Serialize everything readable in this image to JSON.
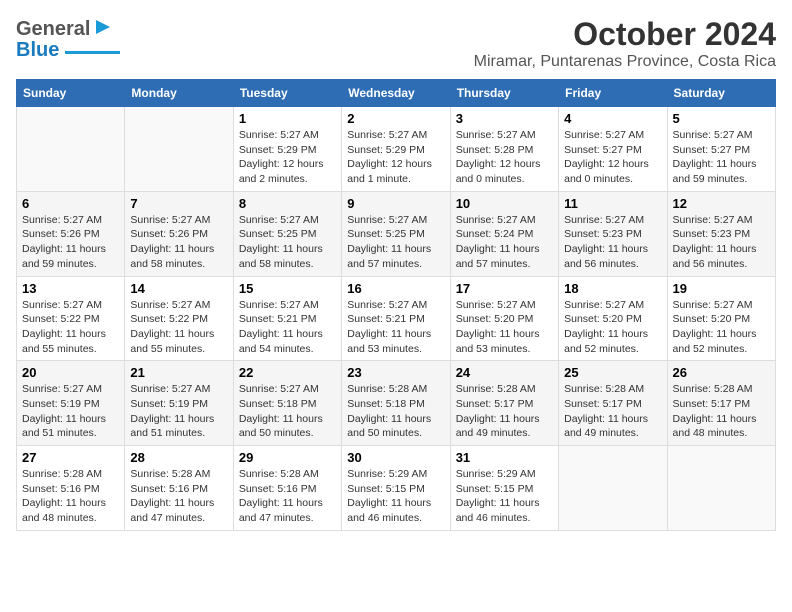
{
  "header": {
    "title": "October 2024",
    "subtitle": "Miramar, Puntarenas Province, Costa Rica",
    "logo_general": "General",
    "logo_blue": "Blue"
  },
  "columns": [
    "Sunday",
    "Monday",
    "Tuesday",
    "Wednesday",
    "Thursday",
    "Friday",
    "Saturday"
  ],
  "weeks": [
    {
      "days": [
        {
          "date": "",
          "sunrise": "",
          "sunset": "",
          "daylight": ""
        },
        {
          "date": "",
          "sunrise": "",
          "sunset": "",
          "daylight": ""
        },
        {
          "date": "1",
          "sunrise": "Sunrise: 5:27 AM",
          "sunset": "Sunset: 5:29 PM",
          "daylight": "Daylight: 12 hours and 2 minutes."
        },
        {
          "date": "2",
          "sunrise": "Sunrise: 5:27 AM",
          "sunset": "Sunset: 5:29 PM",
          "daylight": "Daylight: 12 hours and 1 minute."
        },
        {
          "date": "3",
          "sunrise": "Sunrise: 5:27 AM",
          "sunset": "Sunset: 5:28 PM",
          "daylight": "Daylight: 12 hours and 0 minutes."
        },
        {
          "date": "4",
          "sunrise": "Sunrise: 5:27 AM",
          "sunset": "Sunset: 5:27 PM",
          "daylight": "Daylight: 12 hours and 0 minutes."
        },
        {
          "date": "5",
          "sunrise": "Sunrise: 5:27 AM",
          "sunset": "Sunset: 5:27 PM",
          "daylight": "Daylight: 11 hours and 59 minutes."
        }
      ]
    },
    {
      "days": [
        {
          "date": "6",
          "sunrise": "Sunrise: 5:27 AM",
          "sunset": "Sunset: 5:26 PM",
          "daylight": "Daylight: 11 hours and 59 minutes."
        },
        {
          "date": "7",
          "sunrise": "Sunrise: 5:27 AM",
          "sunset": "Sunset: 5:26 PM",
          "daylight": "Daylight: 11 hours and 58 minutes."
        },
        {
          "date": "8",
          "sunrise": "Sunrise: 5:27 AM",
          "sunset": "Sunset: 5:25 PM",
          "daylight": "Daylight: 11 hours and 58 minutes."
        },
        {
          "date": "9",
          "sunrise": "Sunrise: 5:27 AM",
          "sunset": "Sunset: 5:25 PM",
          "daylight": "Daylight: 11 hours and 57 minutes."
        },
        {
          "date": "10",
          "sunrise": "Sunrise: 5:27 AM",
          "sunset": "Sunset: 5:24 PM",
          "daylight": "Daylight: 11 hours and 57 minutes."
        },
        {
          "date": "11",
          "sunrise": "Sunrise: 5:27 AM",
          "sunset": "Sunset: 5:23 PM",
          "daylight": "Daylight: 11 hours and 56 minutes."
        },
        {
          "date": "12",
          "sunrise": "Sunrise: 5:27 AM",
          "sunset": "Sunset: 5:23 PM",
          "daylight": "Daylight: 11 hours and 56 minutes."
        }
      ]
    },
    {
      "days": [
        {
          "date": "13",
          "sunrise": "Sunrise: 5:27 AM",
          "sunset": "Sunset: 5:22 PM",
          "daylight": "Daylight: 11 hours and 55 minutes."
        },
        {
          "date": "14",
          "sunrise": "Sunrise: 5:27 AM",
          "sunset": "Sunset: 5:22 PM",
          "daylight": "Daylight: 11 hours and 55 minutes."
        },
        {
          "date": "15",
          "sunrise": "Sunrise: 5:27 AM",
          "sunset": "Sunset: 5:21 PM",
          "daylight": "Daylight: 11 hours and 54 minutes."
        },
        {
          "date": "16",
          "sunrise": "Sunrise: 5:27 AM",
          "sunset": "Sunset: 5:21 PM",
          "daylight": "Daylight: 11 hours and 53 minutes."
        },
        {
          "date": "17",
          "sunrise": "Sunrise: 5:27 AM",
          "sunset": "Sunset: 5:20 PM",
          "daylight": "Daylight: 11 hours and 53 minutes."
        },
        {
          "date": "18",
          "sunrise": "Sunrise: 5:27 AM",
          "sunset": "Sunset: 5:20 PM",
          "daylight": "Daylight: 11 hours and 52 minutes."
        },
        {
          "date": "19",
          "sunrise": "Sunrise: 5:27 AM",
          "sunset": "Sunset: 5:20 PM",
          "daylight": "Daylight: 11 hours and 52 minutes."
        }
      ]
    },
    {
      "days": [
        {
          "date": "20",
          "sunrise": "Sunrise: 5:27 AM",
          "sunset": "Sunset: 5:19 PM",
          "daylight": "Daylight: 11 hours and 51 minutes."
        },
        {
          "date": "21",
          "sunrise": "Sunrise: 5:27 AM",
          "sunset": "Sunset: 5:19 PM",
          "daylight": "Daylight: 11 hours and 51 minutes."
        },
        {
          "date": "22",
          "sunrise": "Sunrise: 5:27 AM",
          "sunset": "Sunset: 5:18 PM",
          "daylight": "Daylight: 11 hours and 50 minutes."
        },
        {
          "date": "23",
          "sunrise": "Sunrise: 5:28 AM",
          "sunset": "Sunset: 5:18 PM",
          "daylight": "Daylight: 11 hours and 50 minutes."
        },
        {
          "date": "24",
          "sunrise": "Sunrise: 5:28 AM",
          "sunset": "Sunset: 5:17 PM",
          "daylight": "Daylight: 11 hours and 49 minutes."
        },
        {
          "date": "25",
          "sunrise": "Sunrise: 5:28 AM",
          "sunset": "Sunset: 5:17 PM",
          "daylight": "Daylight: 11 hours and 49 minutes."
        },
        {
          "date": "26",
          "sunrise": "Sunrise: 5:28 AM",
          "sunset": "Sunset: 5:17 PM",
          "daylight": "Daylight: 11 hours and 48 minutes."
        }
      ]
    },
    {
      "days": [
        {
          "date": "27",
          "sunrise": "Sunrise: 5:28 AM",
          "sunset": "Sunset: 5:16 PM",
          "daylight": "Daylight: 11 hours and 48 minutes."
        },
        {
          "date": "28",
          "sunrise": "Sunrise: 5:28 AM",
          "sunset": "Sunset: 5:16 PM",
          "daylight": "Daylight: 11 hours and 47 minutes."
        },
        {
          "date": "29",
          "sunrise": "Sunrise: 5:28 AM",
          "sunset": "Sunset: 5:16 PM",
          "daylight": "Daylight: 11 hours and 47 minutes."
        },
        {
          "date": "30",
          "sunrise": "Sunrise: 5:29 AM",
          "sunset": "Sunset: 5:15 PM",
          "daylight": "Daylight: 11 hours and 46 minutes."
        },
        {
          "date": "31",
          "sunrise": "Sunrise: 5:29 AM",
          "sunset": "Sunset: 5:15 PM",
          "daylight": "Daylight: 11 hours and 46 minutes."
        },
        {
          "date": "",
          "sunrise": "",
          "sunset": "",
          "daylight": ""
        },
        {
          "date": "",
          "sunrise": "",
          "sunset": "",
          "daylight": ""
        }
      ]
    }
  ]
}
